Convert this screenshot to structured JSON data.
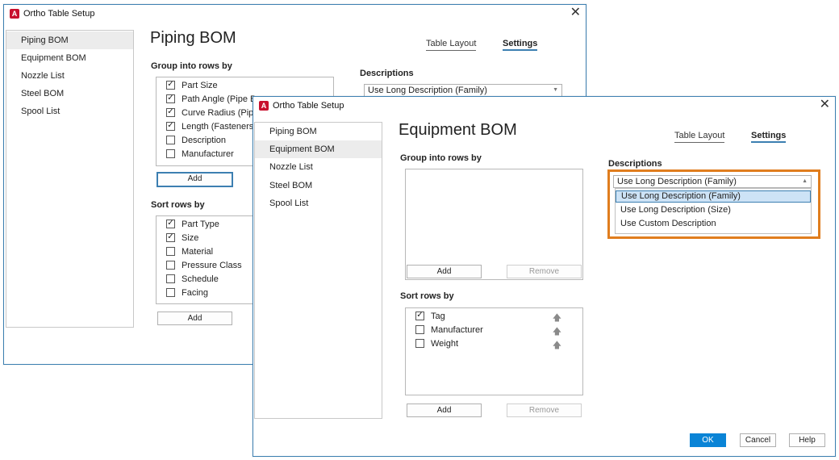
{
  "back_window": {
    "title": "Ortho Table Setup",
    "nav": [
      "Piping BOM",
      "Equipment BOM",
      "Nozzle List",
      "Steel BOM",
      "Spool List"
    ],
    "heading": "Piping BOM",
    "tabs": [
      "Table Layout",
      "Settings"
    ],
    "group_label": "Group into rows by",
    "group_items": [
      {
        "label": "Part Size",
        "checked": true
      },
      {
        "label": "Path Angle (Pipe Be",
        "checked": true
      },
      {
        "label": "Curve Radius (Pipe",
        "checked": true
      },
      {
        "label": "Length (Fasteners)",
        "checked": true
      },
      {
        "label": "Description",
        "checked": false
      },
      {
        "label": "Manufacturer",
        "checked": false
      }
    ],
    "add_label": "Add",
    "sort_label": "Sort rows by",
    "sort_items": [
      {
        "label": "Part Type",
        "checked": true
      },
      {
        "label": "Size",
        "checked": true
      },
      {
        "label": "Material",
        "checked": false
      },
      {
        "label": "Pressure Class",
        "checked": false
      },
      {
        "label": "Schedule",
        "checked": false
      },
      {
        "label": "Facing",
        "checked": false
      }
    ],
    "descriptions_label": "Descriptions",
    "descriptions_value": "Use Long Description (Family)"
  },
  "front_window": {
    "title": "Ortho Table Setup",
    "nav": [
      "Piping BOM",
      "Equipment BOM",
      "Nozzle List",
      "Steel BOM",
      "Spool List"
    ],
    "heading": "Equipment BOM",
    "tabs": [
      "Table Layout",
      "Settings"
    ],
    "group_label": "Group into rows by",
    "add_label": "Add",
    "remove_label": "Remove",
    "sort_label": "Sort rows by",
    "sort_items": [
      {
        "label": "Tag",
        "checked": true
      },
      {
        "label": "Manufacturer",
        "checked": false
      },
      {
        "label": "Weight",
        "checked": false
      }
    ],
    "descriptions_label": "Descriptions",
    "descriptions_value": "Use Long Description (Family)",
    "dropdown_options": [
      "Use Long Description (Family)",
      "Use Long Description (Size)",
      "Use Custom Description"
    ],
    "ok_label": "OK",
    "cancel_label": "Cancel",
    "help_label": "Help"
  },
  "icons": {
    "app": "autocad-a-icon",
    "close": "close-icon",
    "move_up": "arrow-up-icon"
  },
  "colors": {
    "accent": "#0a84d6",
    "highlight": "#e07d1e",
    "window_border": "#3c7fb1"
  }
}
